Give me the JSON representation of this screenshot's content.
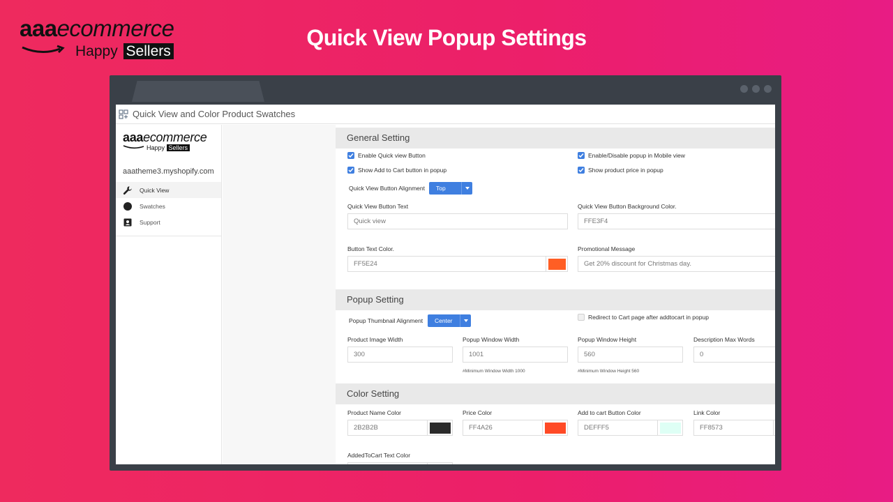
{
  "banner": {
    "logo_bold": "aaa",
    "logo_italic": "ecommerce",
    "logo_sub": "Happy",
    "logo_sub_box": "Sellers",
    "title": "Quick View Popup Settings"
  },
  "window": {
    "app_title": "Quick View and Color Product Swatches"
  },
  "sidebar": {
    "logo_bold": "aaa",
    "logo_italic": "ecommerce",
    "logo_sub": "Happy",
    "logo_sub_box": "Sellers",
    "store": "aaatheme3.myshopify.com",
    "items": [
      {
        "label": "Quick View",
        "icon": "wrench-icon",
        "active": true
      },
      {
        "label": "Swatches",
        "icon": "circle-icon",
        "active": false
      },
      {
        "label": "Support",
        "icon": "contact-icon",
        "active": false
      }
    ]
  },
  "general": {
    "heading": "General Setting",
    "enable_quick_view": "Enable Quick view Button",
    "enable_mobile": "Enable/Disable popup in Mobile view",
    "show_add_to_cart": "Show Add to Cart button in popup",
    "show_price": "Show product price in popup",
    "alignment_label": "Quick View Button Alignment",
    "alignment_value": "Top",
    "button_text_label": "Quick View Button Text",
    "button_text_placeholder": "Quick view",
    "bg_color_label": "Quick View Button Background Color.",
    "bg_color_value": "FFE3F4",
    "text_color_label": "Button Text Color.",
    "text_color_value": "FF5E24",
    "text_color_swatch": "#ff5e24",
    "promo_label": "Promotional Message",
    "promo_value": "Get 20% discount for Christmas day."
  },
  "popup": {
    "heading": "Popup Setting",
    "thumb_align_label": "Popup Thumbnail Alignment",
    "thumb_align_value": "Center",
    "redirect_label": "Redirect to Cart page after addtocart in popup",
    "image_width_label": "Product Image Width",
    "image_width_value": "300",
    "window_width_label": "Popup Window Width",
    "window_width_value": "1001",
    "window_width_note": "#Minimum Window Width 1000",
    "window_height_label": "Popup Window Height",
    "window_height_value": "560",
    "window_height_note": "#Minimum Window Height 560",
    "desc_words_label": "Description Max Words",
    "desc_words_value": "0"
  },
  "color": {
    "heading": "Color Setting",
    "name_label": "Product Name Color",
    "name_value": "2B2B2B",
    "name_swatch": "#2b2b2b",
    "price_label": "Price Color",
    "price_value": "FF4A26",
    "price_swatch": "#ff4a26",
    "cart_label": "Add to cart Button Color",
    "cart_value": "DEFFF5",
    "cart_swatch": "#deFFF5",
    "link_label": "Link Color",
    "link_value": "FF8573",
    "link_swatch": "#ff8573",
    "added_label": "AddedToCart Text Color"
  },
  "colors": {
    "accent": "#3f7fe0",
    "background_left": "#ee2a5e",
    "background_right": "#e81c84"
  }
}
